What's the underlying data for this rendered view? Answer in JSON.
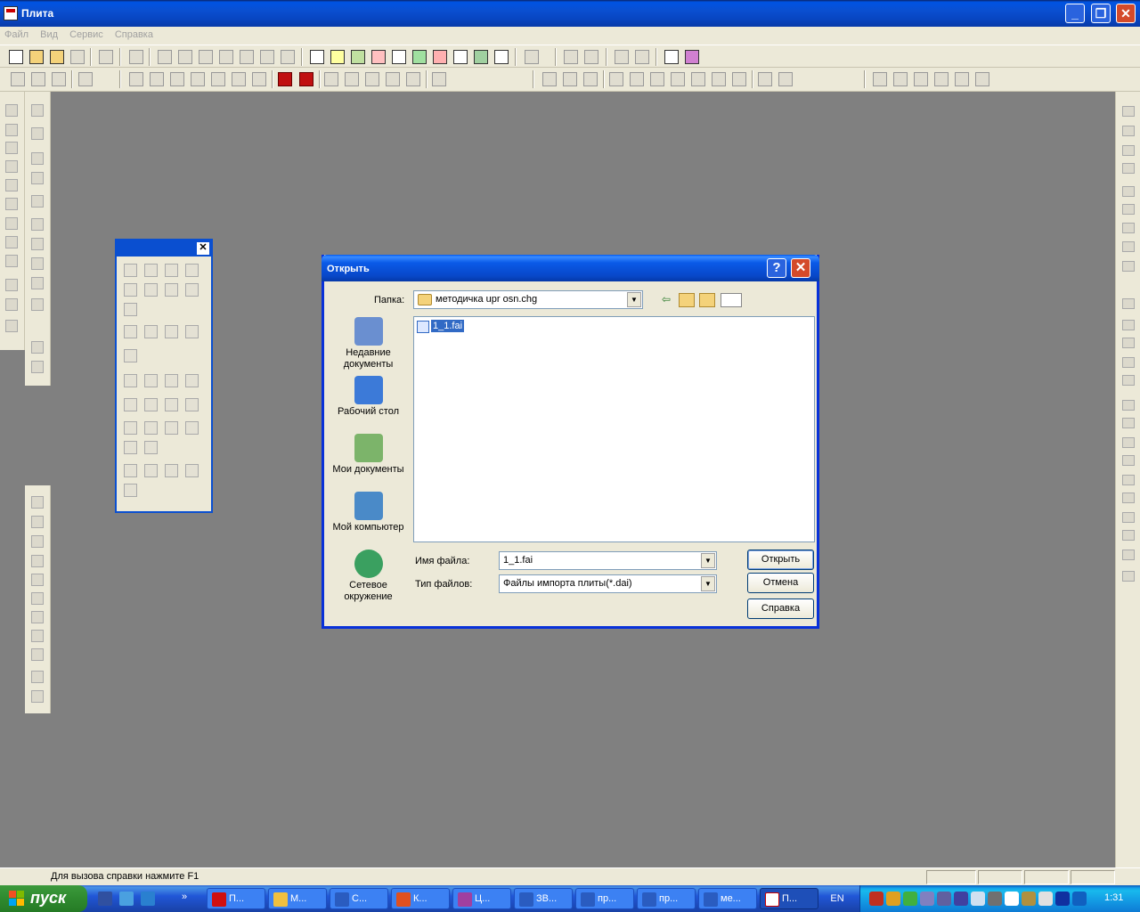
{
  "window": {
    "title": "Плита",
    "icon": "app-icon"
  },
  "menu": [
    "Файл",
    "Вид",
    "Сервис",
    "Справка"
  ],
  "status": {
    "text": "Для вызова справки нажмите F1"
  },
  "dialog": {
    "title": "Открыть",
    "folder_label": "Папка:",
    "folder_value": "методичка upr osn.chg",
    "places": [
      {
        "label": "Недавние документы",
        "icon": "recent-documents-icon",
        "color": "#6a8fd0"
      },
      {
        "label": "Рабочий стол",
        "icon": "desktop-icon",
        "color": "#3c7ad8"
      },
      {
        "label": "Мои документы",
        "icon": "my-documents-icon",
        "color": "#7cb46a"
      },
      {
        "label": "Мой компьютер",
        "icon": "my-computer-icon",
        "color": "#4a8ac8"
      },
      {
        "label": "Сетевое окружение",
        "icon": "network-icon",
        "color": "#3aa060"
      }
    ],
    "files": [
      {
        "name": "1_1.fai",
        "selected": true
      }
    ],
    "filename_label": "Имя файла:",
    "filename_value": "1_1.fai",
    "filetype_label": "Тип файлов:",
    "filetype_value": "Файлы импорта плиты(*.dai)",
    "buttons": {
      "open": "Открыть",
      "cancel": "Отмена",
      "help": "Справка"
    }
  },
  "taskbar": {
    "start_label": "пуск",
    "tasks": [
      {
        "label": "П...",
        "icon": "opera-icon",
        "color": "#d01010"
      },
      {
        "label": "М...",
        "icon": "folder-icon",
        "color": "#f0c040"
      },
      {
        "label": "С...",
        "icon": "word-icon",
        "color": "#2a5cc0"
      },
      {
        "label": "К...",
        "icon": "table-icon",
        "color": "#e05020"
      },
      {
        "label": "Ц...",
        "icon": "book-icon",
        "color": "#a040a0"
      },
      {
        "label": "ЗВ...",
        "icon": "word-icon",
        "color": "#2a5cc0"
      },
      {
        "label": "пр...",
        "icon": "word-icon",
        "color": "#2a5cc0"
      },
      {
        "label": "пр...",
        "icon": "word-icon",
        "color": "#2a5cc0"
      },
      {
        "label": "ме...",
        "icon": "word-icon",
        "color": "#2a5cc0"
      },
      {
        "label": "П...",
        "icon": "app-icon",
        "color": "#ffffff",
        "active": true
      }
    ],
    "lang": "EN",
    "clock": "1:31"
  }
}
